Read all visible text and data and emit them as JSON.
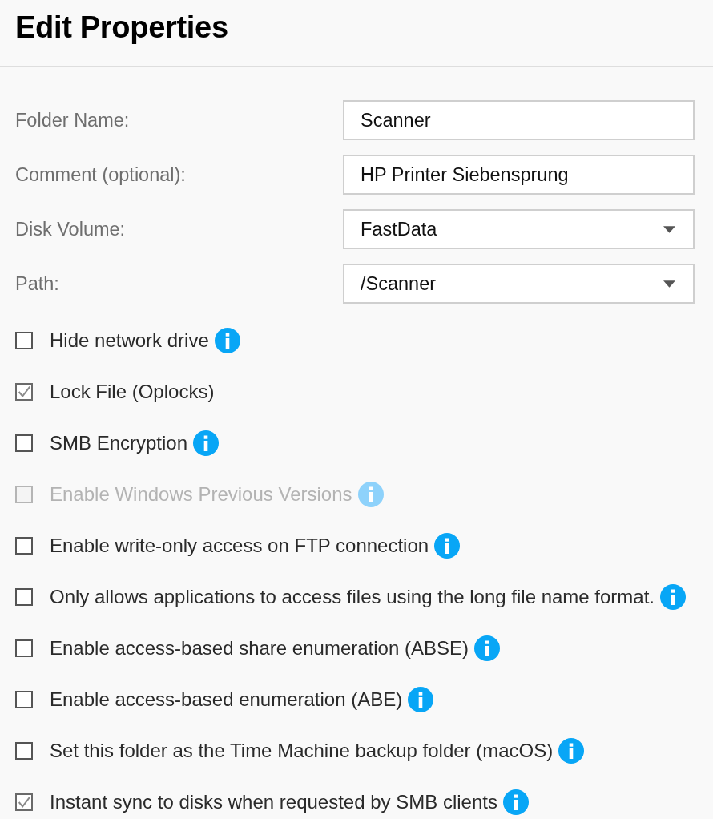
{
  "title": "Edit Properties",
  "fields": [
    {
      "label": "Folder Name:",
      "kind": "text",
      "value": "Scanner"
    },
    {
      "label": "Comment (optional):",
      "kind": "text",
      "value": "HP Printer Siebensprung"
    },
    {
      "label": "Disk Volume:",
      "kind": "select",
      "value": "FastData"
    },
    {
      "label": "Path:",
      "kind": "select",
      "value": "/Scanner"
    }
  ],
  "options": [
    {
      "label": "Hide network drive",
      "checked": false,
      "disabled": false,
      "info": true
    },
    {
      "label": "Lock File (Oplocks)",
      "checked": true,
      "disabled": false,
      "info": false
    },
    {
      "label": "SMB Encryption",
      "checked": false,
      "disabled": false,
      "info": true
    },
    {
      "label": "Enable Windows Previous Versions",
      "checked": false,
      "disabled": true,
      "info": true
    },
    {
      "label": "Enable write-only access on FTP connection",
      "checked": false,
      "disabled": false,
      "info": true
    },
    {
      "label": "Only allows applications to access files using the long file name format.",
      "checked": false,
      "disabled": false,
      "info": true
    },
    {
      "label": "Enable access-based share enumeration (ABSE)",
      "checked": false,
      "disabled": false,
      "info": true
    },
    {
      "label": "Enable access-based enumeration (ABE)",
      "checked": false,
      "disabled": false,
      "info": true
    },
    {
      "label": "Set this folder as the Time Machine backup folder (macOS)",
      "checked": false,
      "disabled": false,
      "info": true
    },
    {
      "label": "Instant sync to disks when requested by SMB clients",
      "checked": true,
      "disabled": false,
      "info": true
    }
  ]
}
